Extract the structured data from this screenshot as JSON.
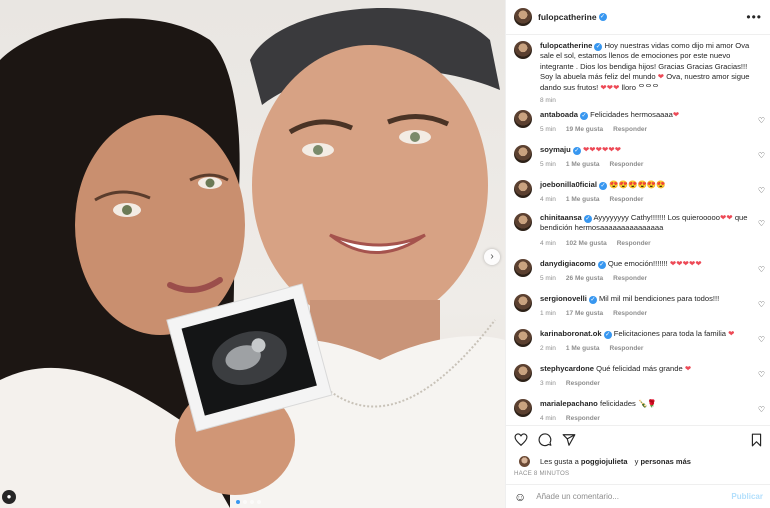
{
  "post": {
    "username": "fulopcatherine",
    "caption_text": "Hoy nuestras vidas como dijo mi amor Ova sale el sol, estamos llenos de emociones por este nuevo integrante . Dios los bendiga hijos! Gracias Gracias Gracias!!! Soy la abuela más feliz del mundo ",
    "caption_tail": " Ova, nuestro amor sigue dando sus frutos! ",
    "caption_end": " lloro ",
    "caption_end_glyphs": "ᄋᄋᄋ",
    "caption_time": "8 min",
    "more_icon": "•••"
  },
  "comments": [
    {
      "username": "antaboada",
      "verified": true,
      "text": "Felicidades hermosaaaa",
      "emoji": "❤",
      "time": "5 min",
      "likes": "19 Me gusta",
      "reply": "Responder"
    },
    {
      "username": "soymaju",
      "verified": true,
      "text": "",
      "emoji": "❤❤❤❤❤❤",
      "time": "5 min",
      "likes": "1 Me gusta",
      "reply": "Responder"
    },
    {
      "username": "joebonilla0ficial",
      "verified": true,
      "text": "",
      "emoji": "😍😍😍😍😍😍",
      "time": "4 min",
      "likes": "1 Me gusta",
      "reply": "Responder"
    },
    {
      "username": "chinitaansa",
      "verified": true,
      "text": "Ayyyyyyyy Cathy!!!!!!! Los quierooooo",
      "emoji": "❤❤",
      "text2": " que bendición hermosaaaaaaaaaaaaaaa",
      "time": "4 min",
      "likes": "102 Me gusta",
      "reply": "Responder"
    },
    {
      "username": "danydigiacomo",
      "verified": true,
      "text": "Que emoción!!!!!!!",
      "emoji": "❤❤❤❤❤",
      "time": "5 min",
      "likes": "26 Me gusta",
      "reply": "Responder"
    },
    {
      "username": "sergionovelli",
      "verified": true,
      "text": "Mil mil mil bendiciones para todos!!!",
      "emoji": "",
      "time": "1 min",
      "likes": "17 Me gusta",
      "reply": "Responder"
    },
    {
      "username": "karinaboronat.ok",
      "verified": true,
      "text": "Felicitaciones para toda la familia",
      "emoji": "❤",
      "time": "2 min",
      "likes": "1 Me gusta",
      "reply": "Responder"
    },
    {
      "username": "stephycardone",
      "verified": false,
      "text": "Qué felicidad más grande",
      "emoji": "❤",
      "time": "3 min",
      "likes": "",
      "reply": "Responder"
    },
    {
      "username": "marialepachano",
      "verified": false,
      "text": "felicidades",
      "emoji": "🍾🌹",
      "time": "4 min",
      "likes": "",
      "reply": "Responder"
    }
  ],
  "actions": {
    "heart_icon": "heart-icon",
    "comment_icon": "comment-icon",
    "share_icon": "share-icon",
    "save_icon": "bookmark-icon",
    "likes_prefix": "Les gusta a ",
    "likes_user": "poggiojulieta",
    "likes_conj": " y ",
    "likes_others": "personas más",
    "time_ago": "HACE 8 MINUTOS"
  },
  "composer": {
    "placeholder": "Añade un comentario...",
    "publish": "Publicar",
    "smile_icon": "☺"
  },
  "colors": {
    "link_blue": "#3897f0",
    "heart_red": "#ed4956",
    "meta_gray": "#8e8e8e"
  }
}
